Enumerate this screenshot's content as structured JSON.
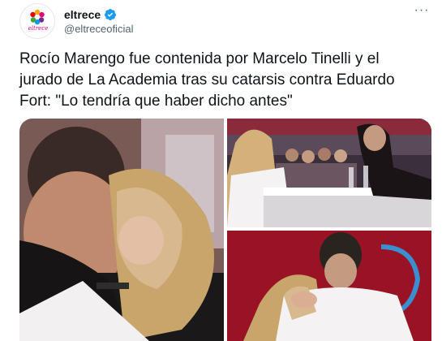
{
  "account": {
    "display_name": "eltrece",
    "handle": "@eltreceoficial",
    "avatar_logo_text": "eltrece",
    "verified": true
  },
  "more_menu": {
    "label": "···"
  },
  "tweet": {
    "text": "Rocío Marengo fue contenida por Marcelo Tinelli y el jurado de La Academia tras su catarsis contra Eduardo Fort: \"Lo tendría que haber dicho antes\""
  },
  "colors": {
    "verified_blue": "#1d9bf0",
    "brand_pink": "#e2007a",
    "text_primary": "#0f1419",
    "text_secondary": "#536471"
  },
  "icons": {
    "verified": "verified-badge-icon",
    "more": "more-dots-icon"
  }
}
